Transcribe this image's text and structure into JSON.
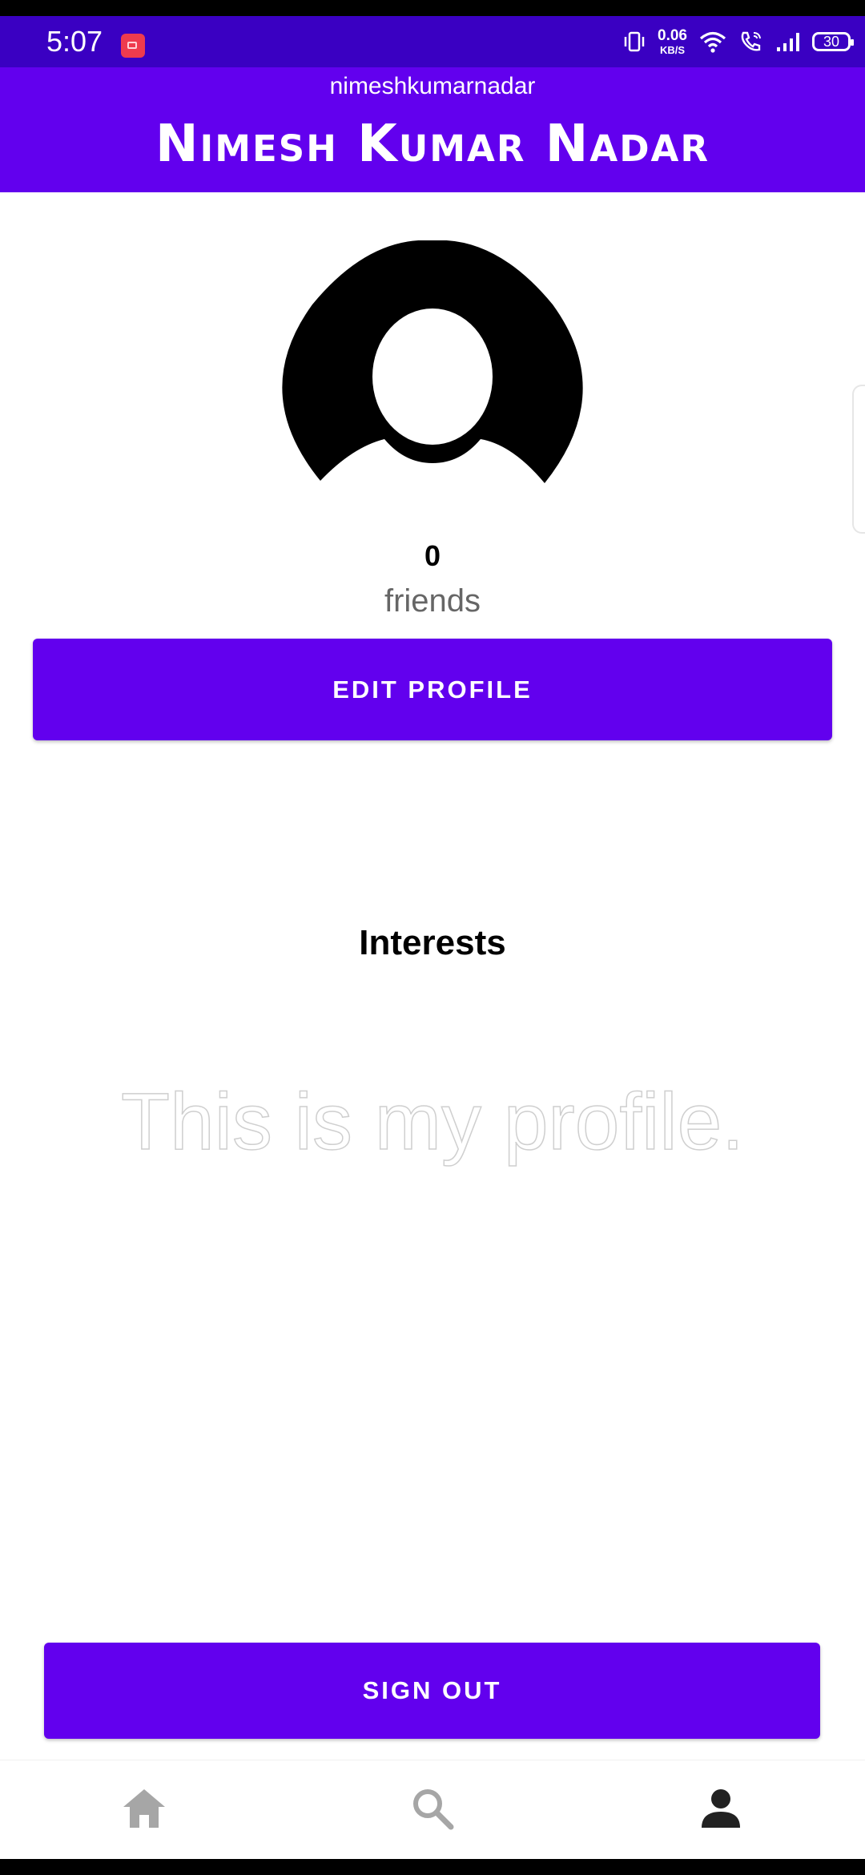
{
  "status_bar": {
    "time": "5:07",
    "net_speed_value": "0.06",
    "net_speed_unit": "KB/S",
    "battery": "30"
  },
  "header": {
    "username": "nimeshkumarnadar",
    "display_name": "Nimesh Kumar Nadar"
  },
  "profile": {
    "friends_count": "0",
    "friends_label": "friends",
    "edit_button": "EDIT PROFILE",
    "interests_title": "Interests",
    "bio": "This is my profile."
  },
  "actions": {
    "sign_out": "SIGN OUT"
  },
  "bottom_nav": {
    "items": [
      "home-icon",
      "search-icon",
      "person-icon"
    ],
    "active": "person-icon"
  },
  "colors": {
    "primary": "#6200ee",
    "status_bar": "#3a00c2",
    "nav_inactive": "#a6a6a6",
    "nav_active": "#222222"
  }
}
